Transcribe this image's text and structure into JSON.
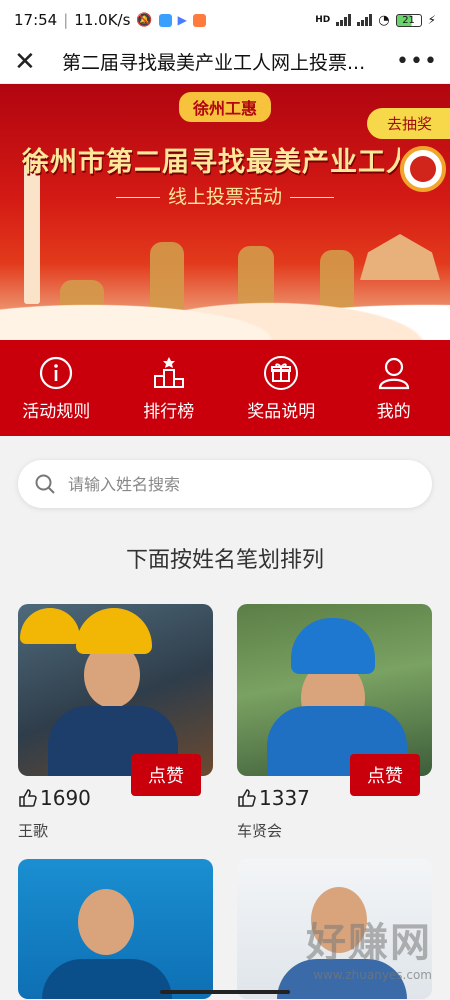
{
  "status": {
    "time": "17:54",
    "network_speed": "11.0K/s",
    "hd_label": "HD",
    "battery": "21"
  },
  "title_bar": {
    "title": "第二届寻找最美产业工人网上投票..."
  },
  "banner": {
    "top_badge": "徐州工惠",
    "lottery_label": "去抽奖",
    "headline": "徐州市第二届寻找最美产业工人评选",
    "subtitle": "线上投票活动"
  },
  "nav": [
    {
      "label": "活动规则",
      "icon": "info-icon"
    },
    {
      "label": "排行榜",
      "icon": "ranking-icon"
    },
    {
      "label": "奖品说明",
      "icon": "gift-icon"
    },
    {
      "label": "我的",
      "icon": "user-icon"
    }
  ],
  "search": {
    "placeholder": "请输入姓名搜索"
  },
  "sort_heading": "下面按姓名笔划排列",
  "candidates": [
    {
      "name": "王歌",
      "votes": "1690",
      "like_label": "点赞"
    },
    {
      "name": "车贤会",
      "votes": "1337",
      "like_label": "点赞"
    },
    {
      "name": "",
      "votes": "",
      "like_label": ""
    },
    {
      "name": "",
      "votes": "",
      "like_label": ""
    }
  ],
  "watermark": {
    "main": "好赚网",
    "url": "www.zhuanyes.com"
  },
  "colors": {
    "primary_red": "#c9000b",
    "gold": "#f7c23c"
  }
}
